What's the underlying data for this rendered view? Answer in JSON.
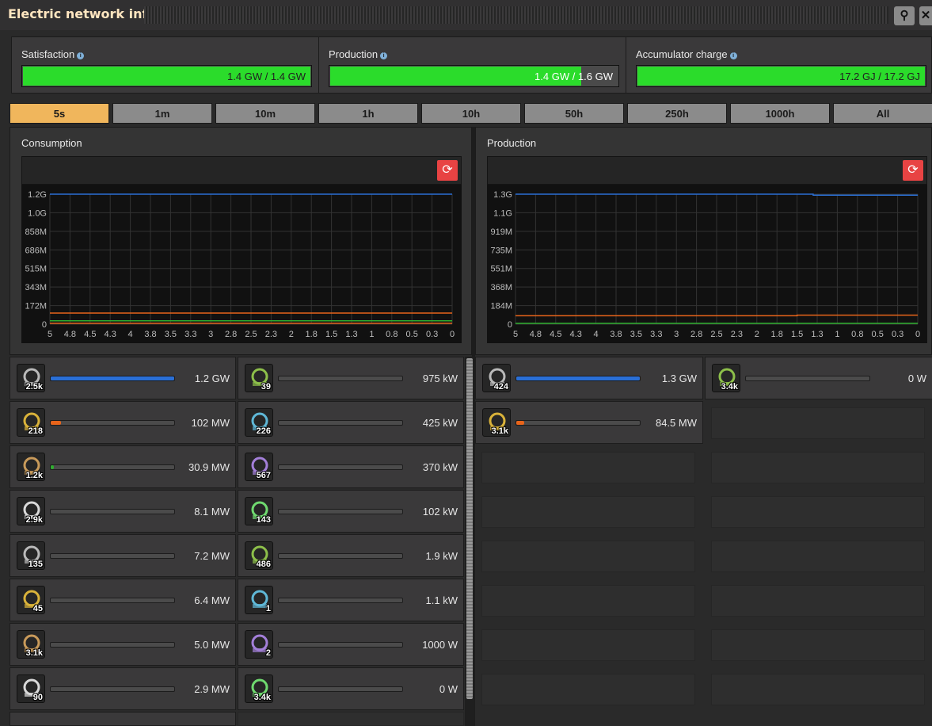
{
  "window": {
    "title": "Electric network info",
    "search_icon": "magnifier-icon",
    "close_icon": "close-icon"
  },
  "summary": [
    {
      "label": "Satisfaction",
      "value": "1.4 GW / 1.4 GW",
      "fill": 1.0
    },
    {
      "label": "Production",
      "value": "1.4 GW / 1.6 GW",
      "fill": 0.875
    },
    {
      "label": "Accumulator charge",
      "value": "17.2 GJ / 17.2 GJ",
      "fill": 1.0
    }
  ],
  "tabs": [
    "5s",
    "1m",
    "10m",
    "1h",
    "10h",
    "50h",
    "250h",
    "1000h",
    "All"
  ],
  "active_tab": "5s",
  "colors": {
    "accent": "#f0b65c",
    "bar_green": "#2bdc2b",
    "reset": "#e84343",
    "series_blue": "#2a6fd6",
    "series_orange": "#e8641a",
    "series_green": "#2fae2f"
  },
  "chart_data": [
    {
      "type": "line",
      "title": "Consumption",
      "y_ticks": [
        "1.2G",
        "1.0G",
        "858M",
        "686M",
        "515M",
        "343M",
        "172M",
        "0"
      ],
      "x_ticks": [
        "5",
        "4.8",
        "4.5",
        "4.3",
        "4",
        "3.8",
        "3.5",
        "3.3",
        "3",
        "2.8",
        "2.5",
        "2.3",
        "2",
        "1.8",
        "1.5",
        "1.3",
        "1",
        "0.8",
        "0.5",
        "0.3",
        "0"
      ],
      "ylim": [
        0,
        1200000000
      ],
      "xlim": [
        5,
        0
      ],
      "grid": true,
      "series": [
        {
          "color": "#2a6fd6",
          "x": [
            5,
            0
          ],
          "y": [
            1200000000,
            1200000000
          ]
        },
        {
          "color": "#e8641a",
          "x": [
            5,
            0
          ],
          "y": [
            102000000,
            102000000
          ]
        },
        {
          "color": "#2fae2f",
          "x": [
            5,
            0
          ],
          "y": [
            30900000,
            30900000
          ]
        },
        {
          "color": "#e8641a",
          "x": [
            5,
            0
          ],
          "y": [
            8100000,
            8100000
          ]
        }
      ]
    },
    {
      "type": "line",
      "title": "Production",
      "y_ticks": [
        "1.3G",
        "1.1G",
        "919M",
        "735M",
        "551M",
        "368M",
        "184M",
        "0"
      ],
      "x_ticks": [
        "5",
        "4.8",
        "4.5",
        "4.3",
        "4",
        "3.8",
        "3.5",
        "3.3",
        "3",
        "2.8",
        "2.5",
        "2.3",
        "2",
        "1.8",
        "1.5",
        "1.3",
        "1",
        "0.8",
        "0.5",
        "0.3",
        "0"
      ],
      "ylim": [
        0,
        1300000000
      ],
      "xlim": [
        5,
        0
      ],
      "grid": true,
      "series": [
        {
          "color": "#2a6fd6",
          "x": [
            5,
            1.3,
            1.3,
            0
          ],
          "y": [
            1300000000,
            1300000000,
            1290000000,
            1290000000
          ]
        },
        {
          "color": "#e8641a",
          "x": [
            5,
            1.5,
            1.5,
            0
          ],
          "y": [
            84500000,
            84500000,
            90000000,
            90000000
          ]
        },
        {
          "color": "#2fae2f",
          "x": [
            5,
            0
          ],
          "y": [
            0,
            0
          ]
        }
      ]
    }
  ],
  "consumption_list": [
    {
      "icon": "radar-icon",
      "count": "2.5k",
      "value": "1.2 GW",
      "fill": 1.0,
      "bar": "blue"
    },
    {
      "icon": "assembling-machine-icon",
      "count": "39",
      "value": "975 kW",
      "fill": 0.0008,
      "bar": "none"
    },
    {
      "icon": "lab-icon",
      "count": "218",
      "value": "102 MW",
      "fill": 0.085,
      "bar": "orange"
    },
    {
      "icon": "fast-inserter-icon",
      "count": "226",
      "value": "425 kW",
      "fill": 0.0004,
      "bar": "none"
    },
    {
      "icon": "roboport-icon",
      "count": "1.2k",
      "value": "30.9 MW",
      "fill": 0.026,
      "bar": "green"
    },
    {
      "icon": "inserter-icon",
      "count": "567",
      "value": "370 kW",
      "fill": 0.0003,
      "bar": "none"
    },
    {
      "icon": "pumpjack-icon",
      "count": "2.9k",
      "value": "8.1 MW",
      "fill": 0.007,
      "bar": "none"
    },
    {
      "icon": "filter-inserter-icon",
      "count": "143",
      "value": "102 kW",
      "fill": 0.0001,
      "bar": "none"
    },
    {
      "icon": "beacon-icon",
      "count": "135",
      "value": "7.2 MW",
      "fill": 0.006,
      "bar": "none"
    },
    {
      "icon": "offshore-pump-icon",
      "count": "486",
      "value": "1.9 kW",
      "fill": 0.0,
      "bar": "none"
    },
    {
      "icon": "electric-mining-drill-icon",
      "count": "45",
      "value": "6.4 MW",
      "fill": 0.005,
      "bar": "none"
    },
    {
      "icon": "locomotive-icon",
      "count": "1",
      "value": "1.1 kW",
      "fill": 0.0,
      "bar": "none"
    },
    {
      "icon": "stack-inserter-icon",
      "count": "3.1k",
      "value": "5.0 MW",
      "fill": 0.004,
      "bar": "none"
    },
    {
      "icon": "long-inserter-icon",
      "count": "2",
      "value": "1000 W",
      "fill": 0.0,
      "bar": "none"
    },
    {
      "icon": "oil-refinery-icon",
      "count": "90",
      "value": "2.9 MW",
      "fill": 0.002,
      "bar": "none"
    },
    {
      "icon": "accumulator-icon",
      "count": "3.4k",
      "value": "0 W",
      "fill": 0.0,
      "bar": "none"
    }
  ],
  "production_list": [
    {
      "icon": "steam-turbine-icon",
      "count": "424",
      "value": "1.3 GW",
      "fill": 1.0,
      "bar": "blue"
    },
    {
      "icon": "accumulator-icon",
      "count": "3.4k",
      "value": "0 W",
      "fill": 0.0,
      "bar": "none"
    },
    {
      "icon": "solar-panel-icon",
      "count": "3.1k",
      "value": "84.5 MW",
      "fill": 0.065,
      "bar": "orange"
    }
  ]
}
